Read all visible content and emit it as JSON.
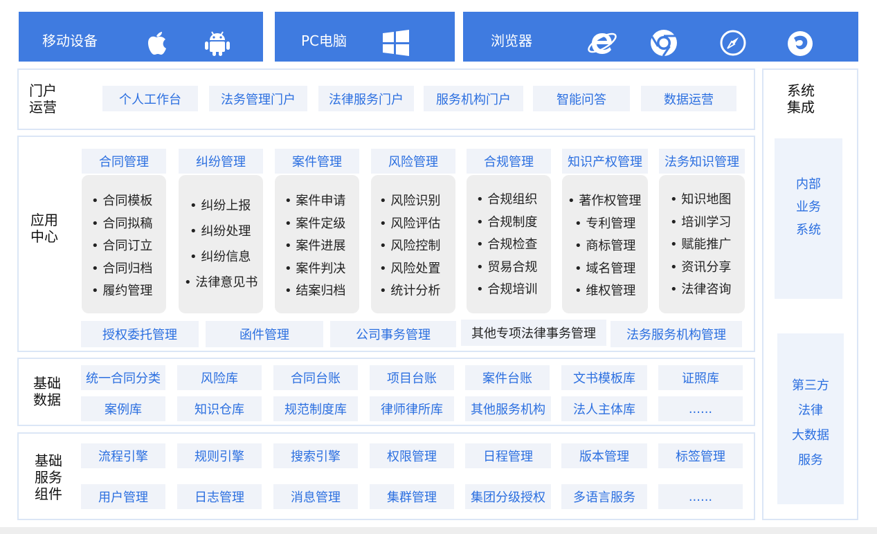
{
  "header": {
    "mobile_label": "移动设备",
    "pc_label": "PC电脑",
    "browser_label": "浏览器"
  },
  "portal": {
    "title_line1": "门户",
    "title_line2": "运营",
    "items": [
      "个人工作台",
      "法务管理门户",
      "法律服务门户",
      "服务机构门户",
      "智能问答",
      "数据运营"
    ]
  },
  "app_center": {
    "title_line1": "应用",
    "title_line2": "中心",
    "modules": [
      {
        "title": "合同管理",
        "items": [
          "• 合同模板",
          "• 合同拟稿",
          "• 合同订立",
          "• 合同归档",
          "• 履约管理"
        ]
      },
      {
        "title": "纠纷管理",
        "items": [
          "• 纠纷上报",
          "• 纠纷处理",
          "• 纠纷信息",
          "• 法律意见书"
        ]
      },
      {
        "title": "案件管理",
        "items": [
          "• 案件申请",
          "• 案件定级",
          "• 案件进展",
          "• 案件判决",
          "• 结案归档"
        ]
      },
      {
        "title": "风险管理",
        "items": [
          "• 风险识别",
          "• 风险评估",
          "• 风险控制",
          "• 风险处置",
          "• 统计分析"
        ]
      },
      {
        "title": "合规管理",
        "items": [
          "• 合规组织",
          "• 合规制度",
          "• 合规检查",
          "• 贸易合规",
          "• 合规培训"
        ]
      },
      {
        "title": "知识产权管理",
        "items": [
          "• 著作权管理",
          "• 专利管理",
          "• 商标管理",
          "• 域名管理",
          "• 维权管理"
        ]
      },
      {
        "title": "法务知识管理",
        "items": [
          "• 知识地图",
          "• 培训学习",
          "• 赋能推广",
          "• 资讯分享",
          "• 法律咨询"
        ]
      }
    ],
    "bottom_items": [
      "授权委托管理",
      "函件管理",
      "公司事务管理",
      "其他专项法律事务管理",
      "法务服务机构管理"
    ]
  },
  "base_data": {
    "title_line1": "基础",
    "title_line2": "数据",
    "row1": [
      "统一合同分类",
      "风险库",
      "合同台账",
      "项目台账",
      "案件台账",
      "文书模板库",
      "证照库"
    ],
    "row2": [
      "案例库",
      "知识仓库",
      "规范制度库",
      "律师律所库",
      "其他服务机构",
      "法人主体库",
      "......"
    ]
  },
  "base_service": {
    "title_line1": "基础",
    "title_line2": "服务",
    "title_line3": "组件",
    "row1": [
      "流程引擎",
      "规则引擎",
      "搜索引擎",
      "权限管理",
      "日程管理",
      "版本管理",
      "标签管理"
    ],
    "row2": [
      "用户管理",
      "日志管理",
      "消息管理",
      "集群管理",
      "集团分级授权",
      "多语言服务",
      "......"
    ]
  },
  "integration": {
    "title_line1": "系统",
    "title_line2": "集成",
    "internal": [
      "内部",
      "业务",
      "系统"
    ],
    "third_party": [
      "第三方",
      "法律",
      "大数据",
      "服务"
    ]
  }
}
